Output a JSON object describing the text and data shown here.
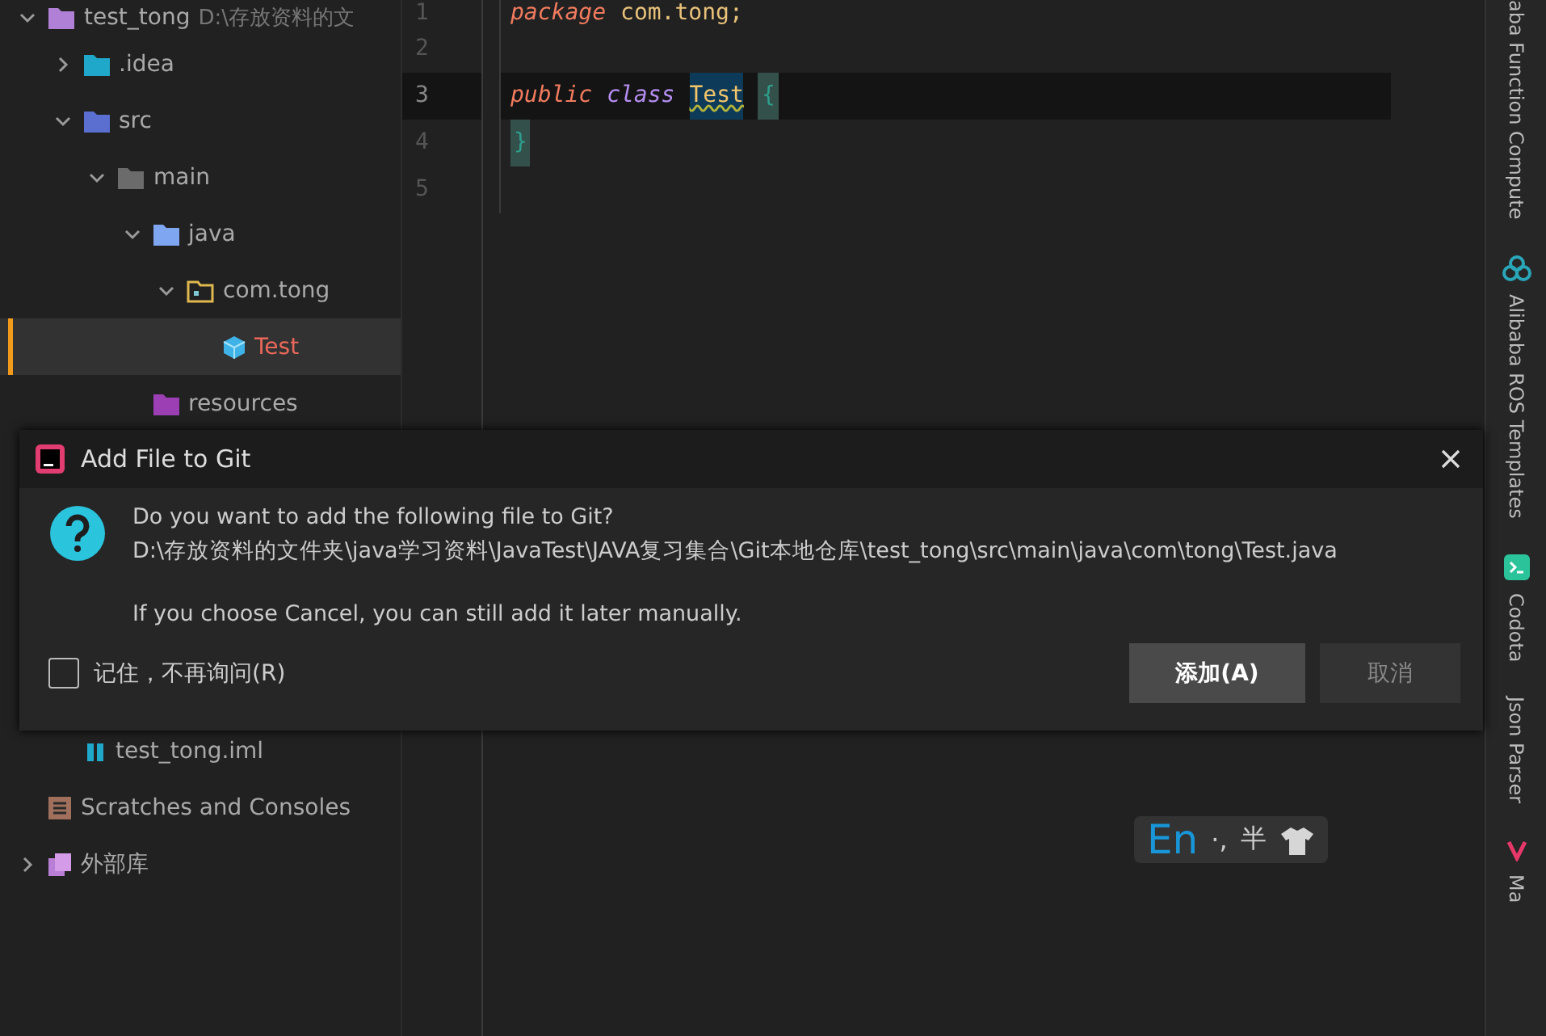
{
  "project_tree": [
    {
      "label": "test_tong",
      "path": "D:\\存放资料的文",
      "kind": "module",
      "expanded": true,
      "selected": false,
      "unversioned": false,
      "children": [
        {
          "label": ".idea",
          "kind": "idea-folder",
          "expanded": false,
          "selected": false,
          "unversioned": false
        },
        {
          "label": "src",
          "kind": "source-root",
          "expanded": true,
          "selected": false,
          "unversioned": false,
          "children": [
            {
              "label": "main",
              "kind": "folder",
              "expanded": true,
              "selected": false,
              "unversioned": false,
              "children": [
                {
                  "label": "java",
                  "kind": "java-folder",
                  "expanded": true,
                  "selected": false,
                  "unversioned": false,
                  "children": [
                    {
                      "label": "com.tong",
                      "kind": "package",
                      "expanded": true,
                      "selected": false,
                      "unversioned": false,
                      "children": [
                        {
                          "label": "Test",
                          "kind": "class",
                          "selected": true,
                          "unversioned": true
                        }
                      ]
                    }
                  ]
                },
                {
                  "label": "resources",
                  "kind": "resources-root",
                  "selected": false,
                  "unversioned": false
                }
              ]
            }
          ]
        },
        {
          "label": "test_tong.iml",
          "kind": "iml",
          "selected": false,
          "unversioned": false
        }
      ]
    },
    {
      "label": "Scratches and Consoles",
      "kind": "scratches",
      "selected": false,
      "unversioned": false
    },
    {
      "label": "外部库",
      "kind": "library",
      "expanded": false,
      "selected": false,
      "unversioned": false
    }
  ],
  "editor": {
    "lines": [
      {
        "number": "1",
        "current": false,
        "tokens": [
          {
            "text": "package",
            "kind": "keyword"
          },
          {
            "text": "com.tong;",
            "kind": "plain"
          }
        ]
      },
      {
        "number": "2",
        "current": false
      },
      {
        "number": "3",
        "current": true,
        "tokens": [
          {
            "text": "public",
            "kind": "keyword"
          },
          {
            "text": "class",
            "kind": "keyword2"
          },
          {
            "text": "Test",
            "kind": "class-name"
          },
          {
            "text": "{",
            "kind": "brace"
          }
        ]
      },
      {
        "number": "4",
        "current": false,
        "tokens": [
          {
            "text": "}",
            "kind": "brace"
          }
        ]
      },
      {
        "number": "5",
        "current": false
      }
    ]
  },
  "right_tool_strip": [
    {
      "label": "aba Function Compute",
      "kind": "none"
    },
    {
      "label": "Alibaba ROS Templates",
      "kind": "ros"
    },
    {
      "label": "Codota",
      "kind": "codota"
    },
    {
      "label": "Json Parser",
      "kind": "none"
    },
    {
      "label": "Ma",
      "kind": "v"
    }
  ],
  "dialog": {
    "title": "Add File to Git",
    "question": "Do you want to add the following file to Git?",
    "path": "D:\\存放资料的文件夹\\java学习资料\\JavaTest\\JAVA复习集合\\Git本地仓库\\test_tong\\src\\main\\java\\com\\tong\\Test.java",
    "note": "If you choose Cancel, you can still add it later manually.",
    "checkbox": {
      "label": "记住，不再询问(R)",
      "checked": false
    },
    "buttons": [
      {
        "label": "添加(A)",
        "default": true
      },
      {
        "label": "取消",
        "default": false
      }
    ]
  },
  "ime_bar": {
    "mode": "En",
    "punctuation": "·,",
    "width": "半"
  }
}
